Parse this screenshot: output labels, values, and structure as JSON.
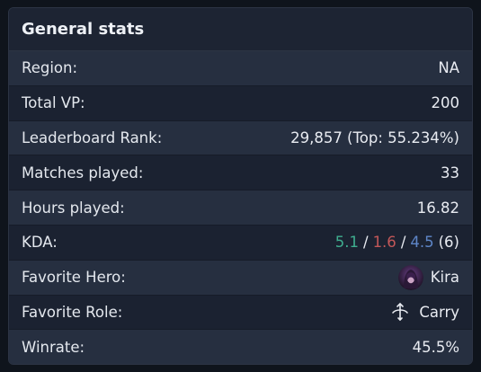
{
  "card": {
    "title": "General stats"
  },
  "stats": {
    "region": {
      "label": "Region:",
      "value": "NA"
    },
    "total_vp": {
      "label": "Total VP:",
      "value": "200"
    },
    "leaderboard_rank": {
      "label": "Leaderboard Rank:",
      "value": "29,857 (Top: 55.234%)"
    },
    "matches_played": {
      "label": "Matches played:",
      "value": "33"
    },
    "hours_played": {
      "label": "Hours played:",
      "value": "16.82"
    },
    "kda": {
      "label": "KDA:",
      "kills": "5.1",
      "deaths": "1.6",
      "assists": "4.5",
      "separator": "/",
      "kda_ratio": "(6)",
      "colors": {
        "kills": "#3fae8f",
        "deaths": "#c25758",
        "assists": "#5e86c8"
      }
    },
    "favorite_hero": {
      "label": "Favorite Hero:",
      "value": "Kira",
      "icon": "hero-portrait-icon"
    },
    "favorite_role": {
      "label": "Favorite Role:",
      "value": "Carry",
      "icon": "bow-icon"
    },
    "winrate": {
      "label": "Winrate:",
      "value": "45.5%"
    }
  }
}
